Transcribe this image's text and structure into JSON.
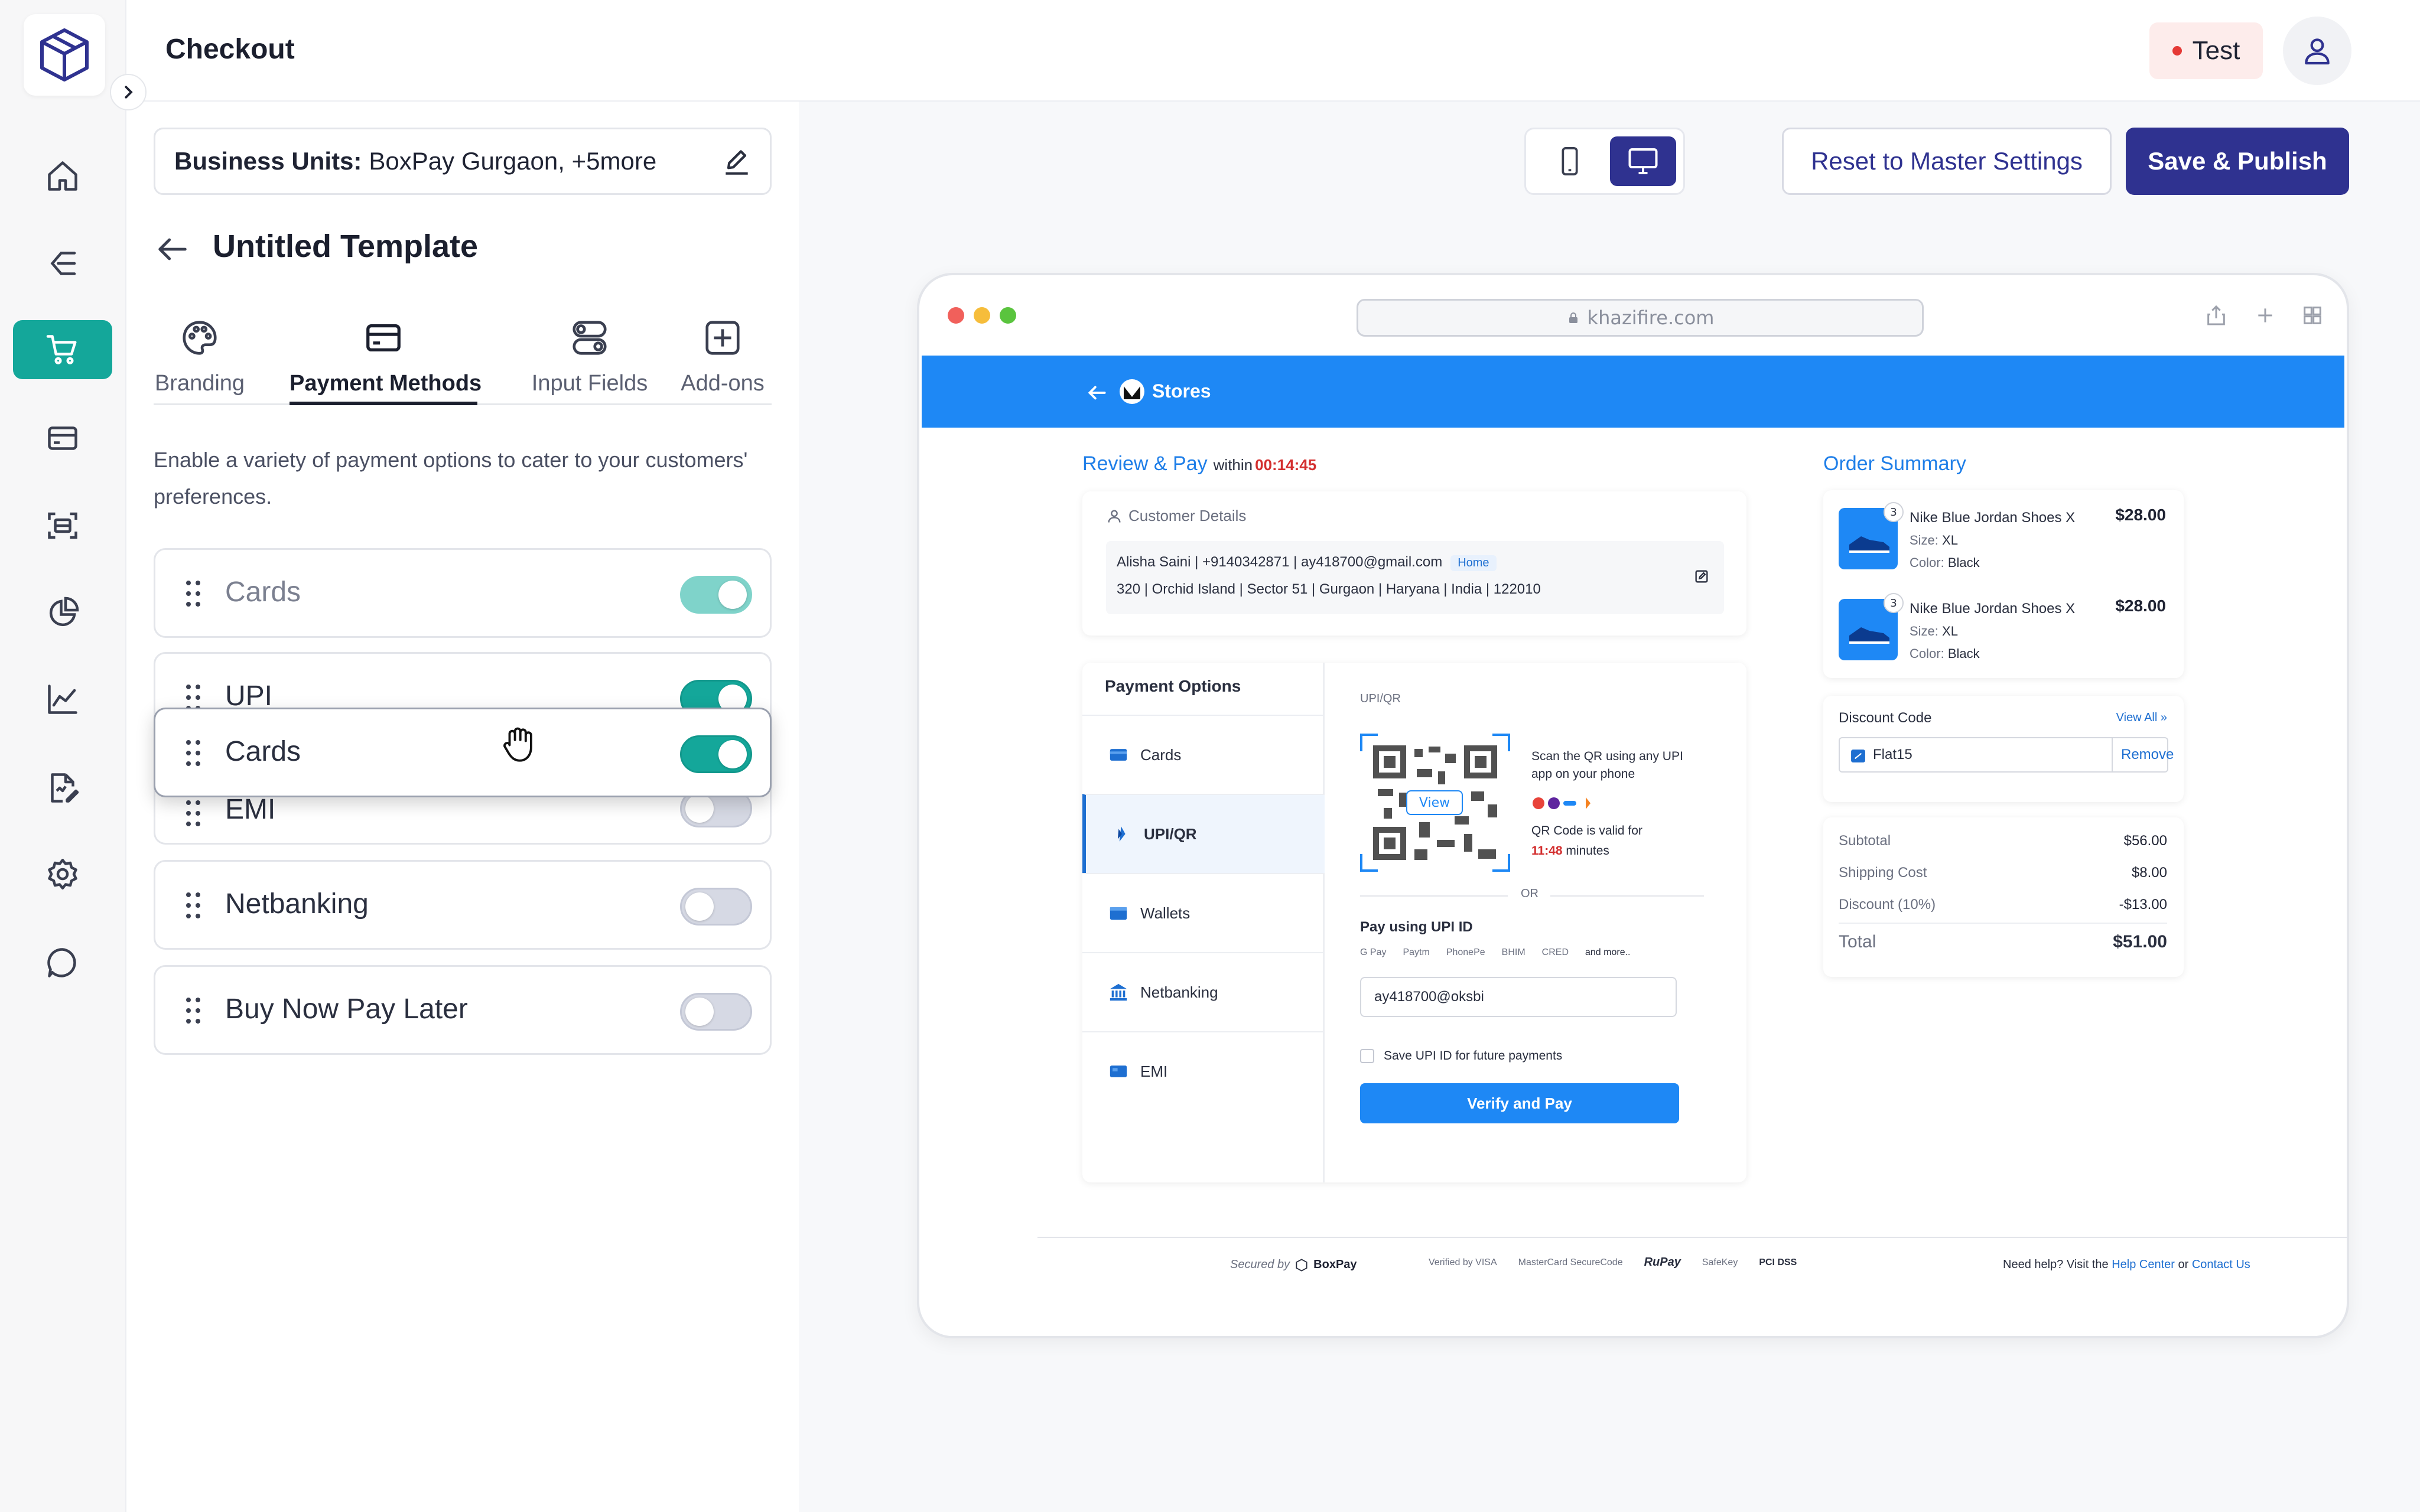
{
  "header": {
    "title": "Checkout",
    "env_badge": "Test"
  },
  "sidebar": {
    "items": [
      {
        "icon": "home-icon"
      },
      {
        "icon": "flow-icon"
      },
      {
        "icon": "cart-icon",
        "active": true
      },
      {
        "icon": "card-icon"
      },
      {
        "icon": "scan-icon"
      },
      {
        "icon": "pie-chart-icon"
      },
      {
        "icon": "analytics-icon"
      },
      {
        "icon": "document-edit-icon"
      },
      {
        "icon": "gear-icon"
      },
      {
        "icon": "chat-icon"
      }
    ]
  },
  "panel": {
    "business_units_label": "Business Units:",
    "business_units_value": "BoxPay Gurgaon, +5more",
    "template_title": "Untitled Template",
    "tabs": [
      {
        "label": "Branding"
      },
      {
        "label": "Payment Methods",
        "active": true
      },
      {
        "label": "Input Fields"
      },
      {
        "label": "Add-ons"
      }
    ],
    "description": "Enable a variety of payment options to cater to your customers' preferences.",
    "methods": [
      {
        "label": "Cards",
        "enabled": true,
        "state": "placeholder"
      },
      {
        "label": "UPI",
        "enabled": true
      },
      {
        "label": "EMI",
        "enabled": false
      },
      {
        "label": "Netbanking",
        "enabled": false
      },
      {
        "label": "Buy Now Pay Later",
        "enabled": false
      }
    ],
    "dragging": {
      "label": "Cards",
      "enabled": true
    }
  },
  "toolbar": {
    "reset_label": "Reset to Master Settings",
    "save_label": "Save & Publish"
  },
  "preview": {
    "url": "khazifire.com",
    "store_name": "Stores",
    "review_title": "Review & Pay",
    "within": "within",
    "timer": "00:14:45",
    "customer": {
      "heading": "Customer Details",
      "line1": "Alisha Saini | +9140342871 | ay418700@gmail.com",
      "tag": "Home",
      "line2": "320 | Orchid Island | Sector 51 | Gurgaon | Haryana | India | 122010"
    },
    "payment_options": {
      "heading": "Payment Options",
      "items": [
        {
          "label": "Cards",
          "icon": "card-icon"
        },
        {
          "label": "UPI/QR",
          "icon": "upi-icon",
          "active": true
        },
        {
          "label": "Wallets",
          "icon": "wallet-icon"
        },
        {
          "label": "Netbanking",
          "icon": "bank-icon"
        },
        {
          "label": "EMI",
          "icon": "emi-icon"
        }
      ]
    },
    "upi": {
      "section_label": "UPI/QR",
      "view_label": "View",
      "scan_text_1": "Scan the QR using any UPI",
      "scan_text_2": "app on your phone",
      "valid_text": "QR Code is valid for",
      "valid_time": "11:48",
      "valid_unit": "minutes",
      "or": "OR",
      "pay_label": "Pay using UPI ID",
      "apps": [
        "G Pay",
        "Paytm",
        "PhonePe",
        "BHIM",
        "CRED",
        "and more.."
      ],
      "upi_value": "ay418700@oksbi",
      "save_label": "Save UPI ID for future payments",
      "verify_label": "Verify and Pay"
    },
    "order_summary": {
      "title": "Order Summary",
      "items": [
        {
          "name": "Nike Blue Jordan Shoes X",
          "size_label": "Size:",
          "size": "XL",
          "color_label": "Color:",
          "color": "Black",
          "price": "$28.00",
          "qty": "3"
        },
        {
          "name": "Nike Blue Jordan Shoes X",
          "size_label": "Size:",
          "size": "XL",
          "color_label": "Color:",
          "color": "Black",
          "price": "$28.00",
          "qty": "3"
        }
      ],
      "discount_label": "Discount Code",
      "view_all": "View All",
      "discount_code": "Flat15",
      "remove": "Remove",
      "subtotal_label": "Subtotal",
      "subtotal": "$56.00",
      "shipping_label": "Shipping Cost",
      "shipping": "$8.00",
      "discount_line_label": "Discount (10%)",
      "discount_line": "-$13.00",
      "total_label": "Total",
      "total": "$51.00"
    },
    "footer": {
      "secured_by": "Secured by",
      "brand": "BoxPay",
      "badges": [
        "Verified by VISA",
        "MasterCard SecureCode",
        "RuPay",
        "SafeKey",
        "PCI DSS"
      ],
      "help_prefix": "Need help? Visit the",
      "help_center": "Help Center",
      "or": "or",
      "contact": "Contact Us"
    }
  },
  "colors": {
    "brand_teal": "#14a79a",
    "primary_indigo": "#2f3290",
    "store_blue": "#1e88f5"
  }
}
